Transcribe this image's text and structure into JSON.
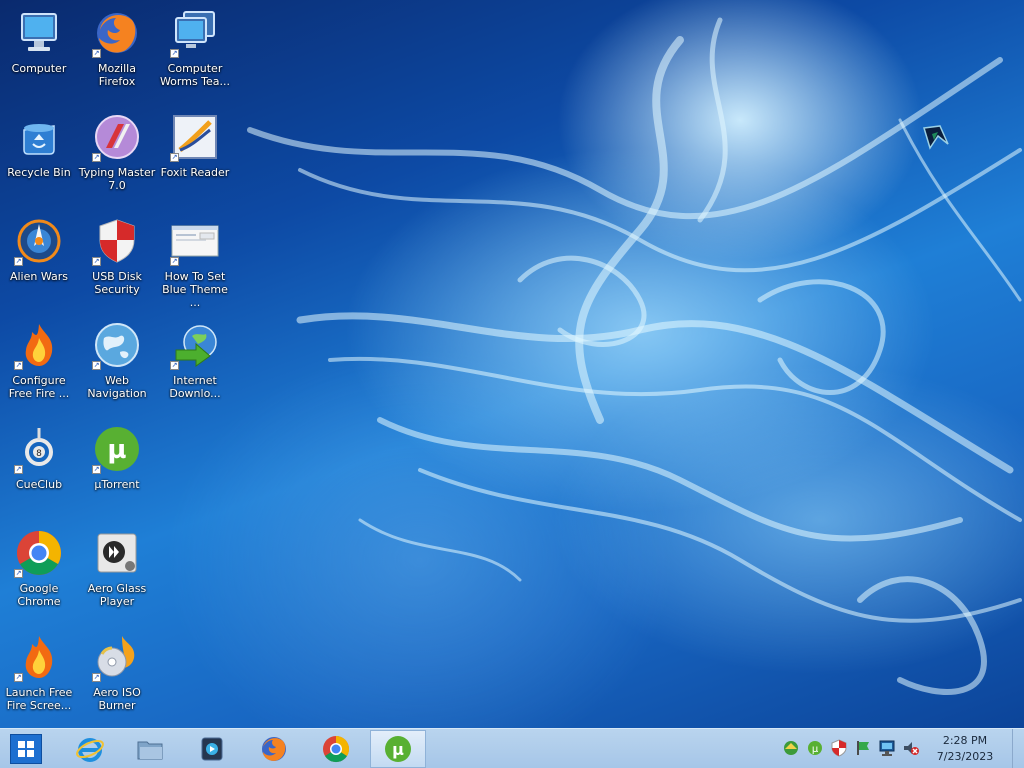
{
  "desktop": {
    "icons": [
      {
        "label": "Computer",
        "icon": "computer-icon"
      },
      {
        "label": "Recycle Bin",
        "icon": "recycle-bin-icon"
      },
      {
        "label": "Alien Wars",
        "icon": "alien-wars-icon"
      },
      {
        "label": "Configure\nFree Fire ...",
        "icon": "fire-icon"
      },
      {
        "label": "CueClub",
        "icon": "cueclub-icon"
      },
      {
        "label": "Google\nChrome",
        "icon": "chrome-icon"
      },
      {
        "label": "Launch Free\nFire Scree...",
        "icon": "fire-icon"
      },
      {
        "label": "Mozilla\nFirefox",
        "icon": "firefox-icon"
      },
      {
        "label": "Typing Master\n7.0",
        "icon": "typing-master-icon"
      },
      {
        "label": "USB Disk\nSecurity",
        "icon": "shield-icon"
      },
      {
        "label": "Web\nNavigation",
        "icon": "globe-icon"
      },
      {
        "label": "µTorrent",
        "icon": "utorrent-icon"
      },
      {
        "label": "Aero Glass\nPlayer",
        "icon": "media-player-icon"
      },
      {
        "label": "Aero ISO\nBurner",
        "icon": "disc-burner-icon"
      },
      {
        "label": "Computer\nWorms Tea...",
        "icon": "computer-icon"
      },
      {
        "label": "Foxit Reader",
        "icon": "foxit-reader-icon"
      },
      {
        "label": "How To Set\nBlue Theme ...",
        "icon": "document-screenshot-icon"
      },
      {
        "label": "Internet\nDownlo...",
        "icon": "internet-download-manager-icon"
      }
    ]
  },
  "taskbar": {
    "start_icon": "windows-logo-icon",
    "pinned": [
      {
        "name": "internet-explorer",
        "icon": "internet-explorer-icon"
      },
      {
        "name": "file-explorer",
        "icon": "folder-icon"
      },
      {
        "name": "media-player",
        "icon": "media-player-icon"
      },
      {
        "name": "firefox",
        "icon": "firefox-icon"
      },
      {
        "name": "chrome",
        "icon": "chrome-icon"
      },
      {
        "name": "utorrent",
        "icon": "utorrent-icon",
        "active": true
      }
    ],
    "tray_icons": [
      "network-globe-icon",
      "utorrent-tray-icon",
      "shield-tray-icon",
      "flag-icon",
      "network-monitor-icon",
      "volume-muted-icon"
    ],
    "clock": {
      "time": "2:28 PM",
      "date": "7/23/2023"
    }
  },
  "colors": {
    "taskbar": "#a6c6e8",
    "desktop_text": "#ffffff"
  }
}
